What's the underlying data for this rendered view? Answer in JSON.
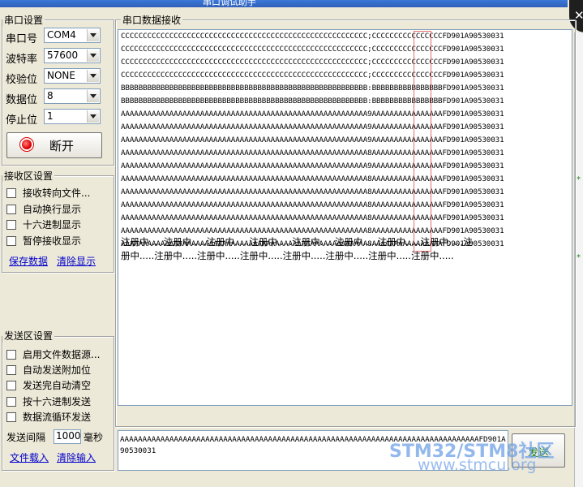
{
  "window": {
    "title": "串口调试助手"
  },
  "serial_settings": {
    "title": "串口设置",
    "fields": [
      {
        "label": "串口号",
        "value": "COM4"
      },
      {
        "label": "波特率",
        "value": "57600"
      },
      {
        "label": "校验位",
        "value": "NONE"
      },
      {
        "label": "数据位",
        "value": "8"
      },
      {
        "label": "停止位",
        "value": "1"
      }
    ],
    "disconnect_label": "断开"
  },
  "receive_settings": {
    "title": "接收区设置",
    "options": [
      "接收转向文件...",
      "自动换行显示",
      "十六进制显示",
      "暂停接收显示"
    ],
    "save_label": "保存数据",
    "clear_label": "清除显示"
  },
  "send_settings": {
    "title": "发送区设置",
    "options": [
      "启用文件数据源...",
      "自动发送附加位",
      "发送完自动清空",
      "按十六进制发送",
      "数据流循环发送"
    ],
    "interval_label": "发送间隔",
    "interval_value": "1000",
    "interval_unit": "毫秒",
    "file_load_label": "文件载入",
    "clear_input_label": "清除输入"
  },
  "receive_panel": {
    "title": "串口数据接收",
    "lines": [
      "CCCCCCCCCCCCCCCCCCCCCCCCCCCCCCCCCCCCCCCCCCCCCCCCCCCCCCCC;CCCCCCCCCCCCCCCCFD901A90530031",
      "CCCCCCCCCCCCCCCCCCCCCCCCCCCCCCCCCCCCCCCCCCCCCCCCCCCCCCCC;CCCCCCCCCCCCCCCCFD901A90530031",
      "CCCCCCCCCCCCCCCCCCCCCCCCCCCCCCCCCCCCCCCCCCCCCCCCCCCCCCCC;CCCCCCCCCCCCCCCCFD901A90530031",
      "CCCCCCCCCCCCCCCCCCCCCCCCCCCCCCCCCCCCCCCCCCCCCCCCCCCCCCCC;CCCCCCCCCCCCCCCCFD901A90530031",
      "BBBBBBBBBBBBBBBBBBBBBBBBBBBBBBBBBBBBBBBBBBBBBBBBBBBBBBBB:BBBBBBBBBBBBBBBBFD901A90530031",
      "BBBBBBBBBBBBBBBBBBBBBBBBBBBBBBBBBBBBBBBBBBBBBBBBBBBBBBBB:BBBBBBBBBBBBBBBBFD901A90530031",
      "AAAAAAAAAAAAAAAAAAAAAAAAAAAAAAAAAAAAAAAAAAAAAAAAAAAAAAAA9AAAAAAAAAAAAAAAAFD901A90530031",
      "AAAAAAAAAAAAAAAAAAAAAAAAAAAAAAAAAAAAAAAAAAAAAAAAAAAAAAAA9AAAAAAAAAAAAAAAAFD901A90530031",
      "AAAAAAAAAAAAAAAAAAAAAAAAAAAAAAAAAAAAAAAAAAAAAAAAAAAAAAAA9AAAAAAAAAAAAAAAAFD901A90530031",
      "AAAAAAAAAAAAAAAAAAAAAAAAAAAAAAAAAAAAAAAAAAAAAAAAAAAAAAAA8AAAAAAAAAAAAAAAAFD901A90530031",
      "AAAAAAAAAAAAAAAAAAAAAAAAAAAAAAAAAAAAAAAAAAAAAAAAAAAAAAAA9AAAAAAAAAAAAAAAAFD901A90530031",
      "AAAAAAAAAAAAAAAAAAAAAAAAAAAAAAAAAAAAAAAAAAAAAAAAAAAAAAAA8AAAAAAAAAAAAAAAAFD901A90530031",
      "AAAAAAAAAAAAAAAAAAAAAAAAAAAAAAAAAAAAAAAAAAAAAAAAAAAAAAAA8AAAAAAAAAAAAAAAAFD901A90530031",
      "AAAAAAAAAAAAAAAAAAAAAAAAAAAAAAAAAAAAAAAAAAAAAAAAAAAAAAAA8AAAAAAAAAAAAAAAAFD901A90530031",
      "AAAAAAAAAAAAAAAAAAAAAAAAAAAAAAAAAAAAAAAAAAAAAAAAAAAAAAAA8AAAAAAAAAAAAAAAAFD901A90530031",
      "AAAAAAAAAAAAAAAAAAAAAAAAAAAAAAAAAAAAAAAAAAAAAAAAAAAAAAAA8AAAAAAAAAAAAAAAAFD901A90530031",
      "AAAAAAAAAAAAAAAAAAAAAAAAAAAAAAAAAAAAAAAAAAAAAAAAAAAAAAAA8AAAAAAAAAAAAAAAAFD901A90530031"
    ],
    "status_lines": [
      "注册中.....注册中.....注册中.....注册中.....注册中.....注册中.....注册中.....注册中.....注",
      "册中.....注册中.....注册中.....注册中.....注册中.....注册中.....注册中.....注册中....."
    ]
  },
  "send_panel": {
    "text": "AAAAAAAAAAAAAAAAAAAAAAAAAAAAAAAAAAAAAAAAAAAAAAAAAAAAAAAAAAAAAAAAAAAAAAAAAAAAAAAAFD901A90530031",
    "send_label": "发送"
  },
  "watermark": {
    "line1": "STM32/STM8社区",
    "line2": "www.stmcu.org"
  }
}
